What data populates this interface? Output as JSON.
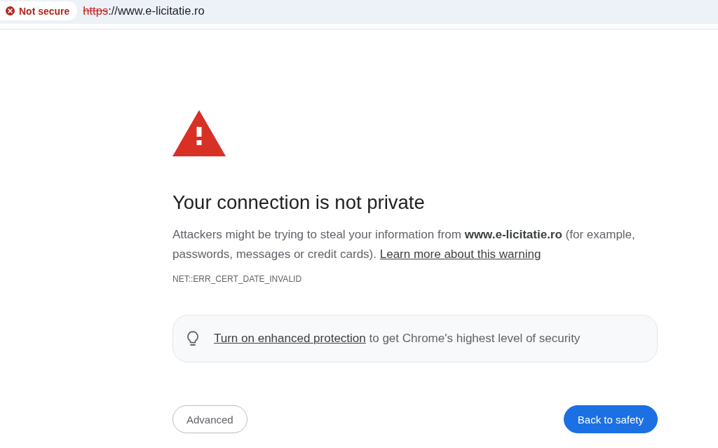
{
  "address_bar": {
    "security_chip": {
      "label": "Not secure"
    },
    "url": {
      "scheme": "https",
      "rest": "://www.e-licitatie.ro"
    }
  },
  "interstitial": {
    "title": "Your connection is not private",
    "message": {
      "text": "Attackers might be trying to steal your information from **www.e-licitatie.ro** (for example, passwords, messages or credit cards).",
      "link": "Learn more about this warning"
    },
    "error_code": "NET::ERR_CERT_DATE_INVALID",
    "promo": {
      "link": "Turn on enhanced protection",
      "text": "to get Chrome's highest level of security"
    },
    "buttons": [
      {
        "label": "Advanced",
        "kind": "secondary"
      },
      {
        "label": "Back to safety",
        "kind": "primary"
      }
    ]
  }
}
